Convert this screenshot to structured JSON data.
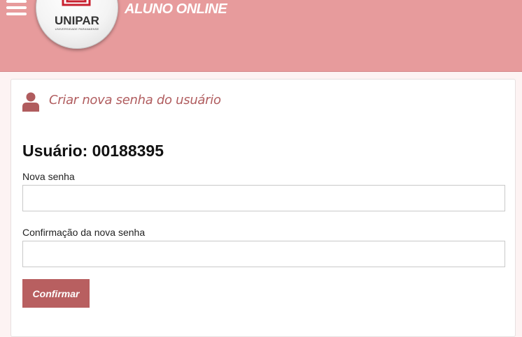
{
  "header": {
    "app_title": "ALUNO ONLINE",
    "logo": {
      "name": "UNIPAR",
      "subtitle": "UNIVERSIDADE PARANAENSE"
    }
  },
  "card": {
    "title": "Criar nova senha do usuário",
    "user_line": "Usuário: 00188395",
    "fields": [
      {
        "label": "Nova senha",
        "value": ""
      },
      {
        "label": "Confirmação da nova senha",
        "value": ""
      }
    ],
    "submit_label": "Confirmar"
  },
  "colors": {
    "header_bg": "#e79b9c",
    "accent": "#b85f60",
    "title_color": "#b05c5e"
  },
  "icons": [
    "menu-icon",
    "user-icon"
  ]
}
